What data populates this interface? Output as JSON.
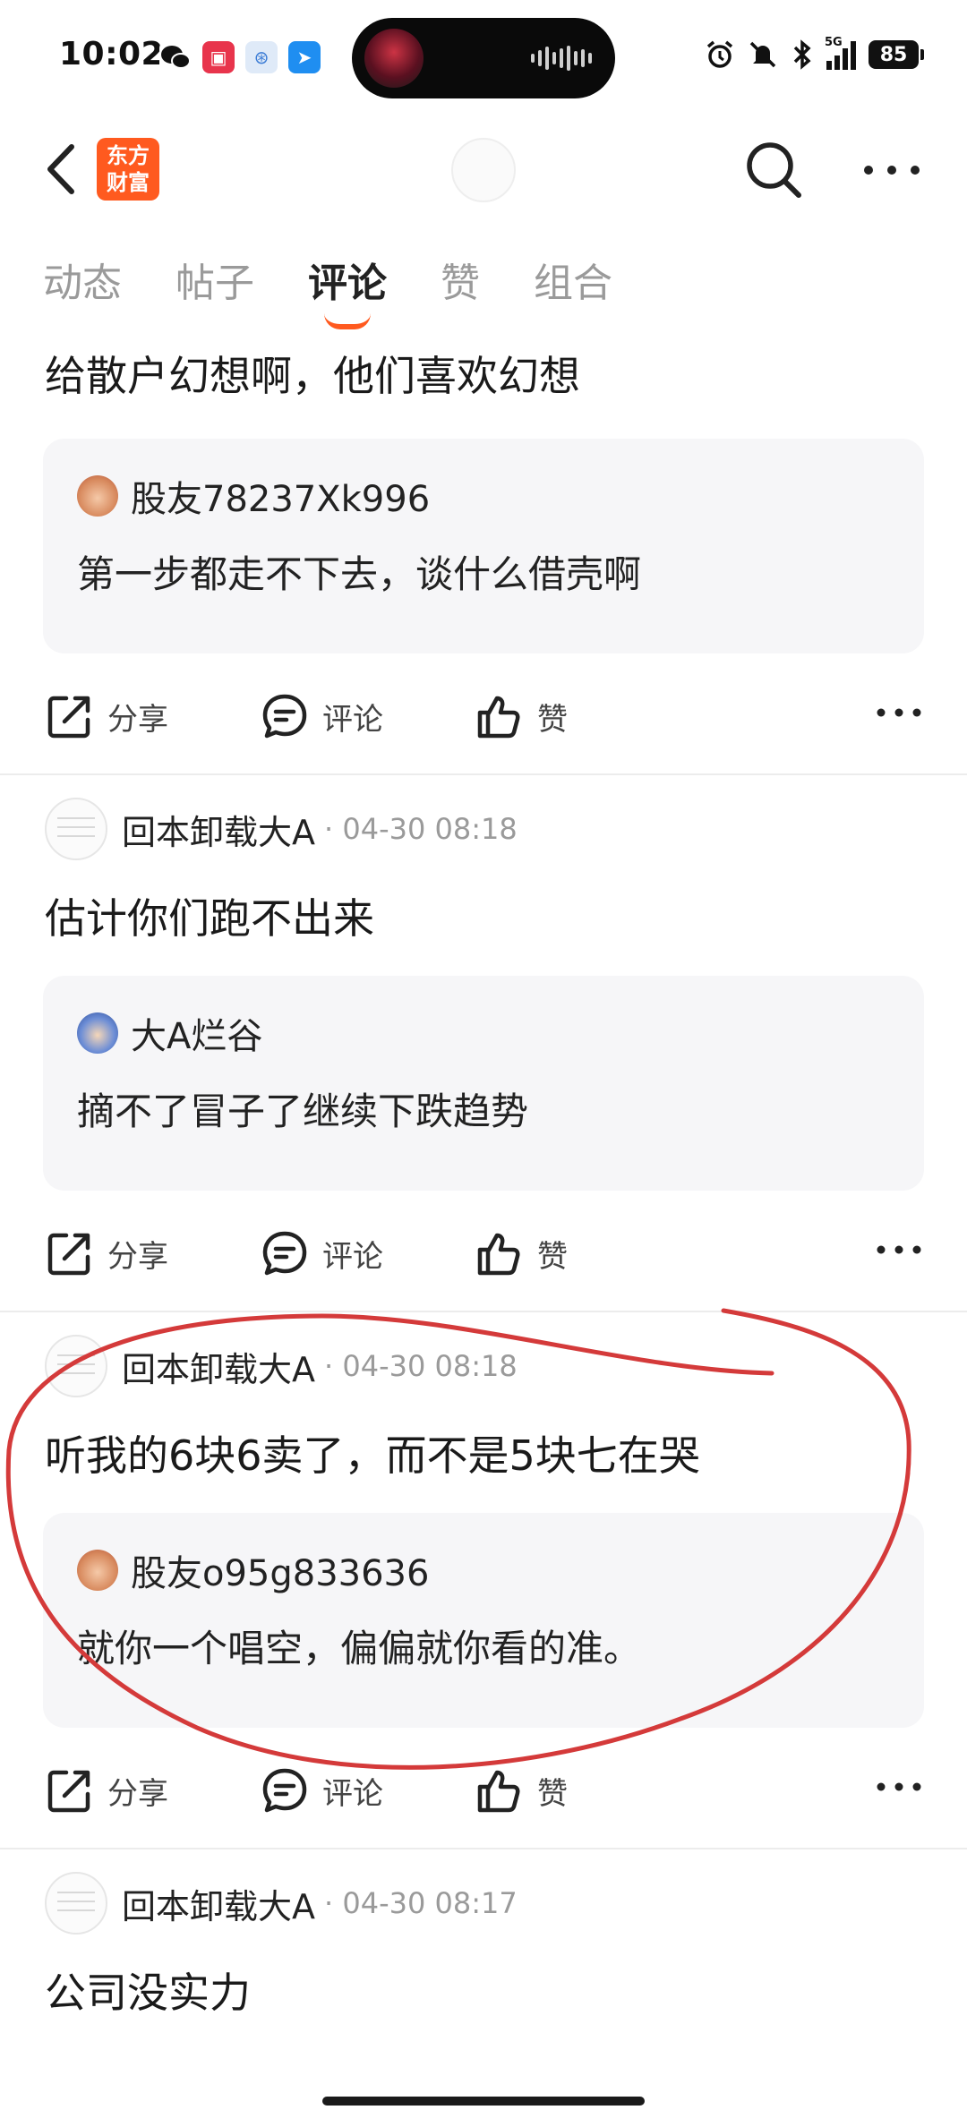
{
  "status_bar": {
    "time": "10:02",
    "network": "5G",
    "battery": "85",
    "left_icons": [
      "wechat-icon",
      "app-red-icon",
      "app-blue-icon",
      "app-dingtalk-icon"
    ],
    "right_icons": [
      "alarm-icon",
      "mute-icon",
      "bluetooth-icon",
      "signal-icon",
      "battery-icon"
    ]
  },
  "header": {
    "logo_text": "东方\n财富",
    "back_icon": "chevron-left-icon",
    "search_icon": "search-icon",
    "more_icon": "more-icon"
  },
  "tabs": [
    {
      "label": "动态",
      "active": false
    },
    {
      "label": "帖子",
      "active": false
    },
    {
      "label": "评论",
      "active": true
    },
    {
      "label": "赞",
      "active": false
    },
    {
      "label": "组合",
      "active": false
    }
  ],
  "colors": {
    "accent": "#ff5a1f",
    "annotation": "#d43a3a",
    "quote_bg": "#f6f6f8"
  },
  "actions": {
    "share": "分享",
    "comment": "评论",
    "like": "赞"
  },
  "posts": [
    {
      "author": "",
      "time": "",
      "text": "给散户幻想啊，他们喜欢幻想",
      "quote": {
        "author": "股友78237Xk996",
        "text": "第一步都走不下去，谈什么借壳啊"
      }
    },
    {
      "author": "回本卸载大A",
      "time": "· 04-30 08:18",
      "text": "估计你们跑不出来",
      "quote": {
        "author": "大A烂谷",
        "text": "摘不了冒子了继续下跌趋势"
      }
    },
    {
      "author": "回本卸载大A",
      "time": "· 04-30 08:18",
      "text": "听我的6块6卖了，而不是5块七在哭",
      "quote": {
        "author": "股友o95g833636",
        "text": "就你一个唱空，偏偏就你看的准。"
      }
    },
    {
      "author": "回本卸载大A",
      "time": "· 04-30 08:17",
      "text": "公司没实力"
    }
  ]
}
